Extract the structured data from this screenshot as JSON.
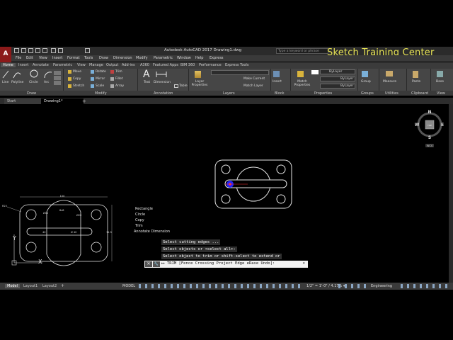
{
  "app": {
    "title": "Autodesk AutoCAD 2017    Drawing1.dwg",
    "search_placeholder": "Type a keyword or phrase",
    "logo_text": "A",
    "watermark": "Sketch Training Center"
  },
  "menu": [
    "File",
    "Edit",
    "View",
    "Insert",
    "Format",
    "Tools",
    "Draw",
    "Dimension",
    "Modify",
    "Parametric",
    "Window",
    "Help",
    "Express"
  ],
  "ribbon_tabs": [
    "Home",
    "Insert",
    "Annotate",
    "Parametric",
    "View",
    "Manage",
    "Output",
    "Add-ins",
    "A360",
    "Featured Apps",
    "BIM 360",
    "Performance",
    "Express Tools"
  ],
  "ribbon": {
    "draw": [
      "Line",
      "Polyline",
      "Circle",
      "Arc"
    ],
    "modify": [
      "Move",
      "Rotate",
      "Trim",
      "Copy",
      "Mirror",
      "Fillet",
      "Stretch",
      "Scale",
      "Array"
    ],
    "annotation": [
      "Text",
      "Dimension",
      "Table"
    ],
    "layers": [
      "Layer Properties",
      "Make Current",
      "Match Layer"
    ],
    "block": [
      "Insert"
    ],
    "properties": [
      "Match Properties",
      "ByLayer",
      "ByLayer",
      "ByLayer"
    ],
    "groups": [
      "Group"
    ],
    "utilities": [
      "Measure"
    ],
    "clipboard": [
      "Paste"
    ],
    "view": [
      "Base"
    ]
  },
  "panels": [
    "Draw",
    "Modify",
    "Annotation",
    "Layers",
    "Block",
    "Properties",
    "Groups",
    "Utilities",
    "Clipboard",
    "View"
  ],
  "file_tabs": [
    "Start",
    "Drawing1*"
  ],
  "viewcube": {
    "n": "N",
    "s": "S",
    "e": "E",
    "w": "W",
    "face": "TOP",
    "wcs": "WCS"
  },
  "context_items": [
    "Rectangle",
    "Circle",
    "Copy",
    "Trim",
    "Annotate Dimension"
  ],
  "command_history": [
    "Select cutting edges ...",
    "Select objects or <select all>:",
    "Select object to trim or shift-select to extend or"
  ],
  "command_line": "TRIM [Fence Crossing Project Edge eRase Undo]:",
  "ref_drawing": {
    "dims": [
      "100",
      "R25",
      "Ø10",
      "Ø20",
      "8x8",
      "11.5",
      "Ø 40",
      "40"
    ]
  },
  "layout_tabs": [
    "Model",
    "Layout1",
    "Layout2"
  ],
  "status": {
    "model": "MODEL",
    "scale": "1/2\" = 1'-0\" / 4.17% ▾",
    "workspace": "Engineering"
  }
}
